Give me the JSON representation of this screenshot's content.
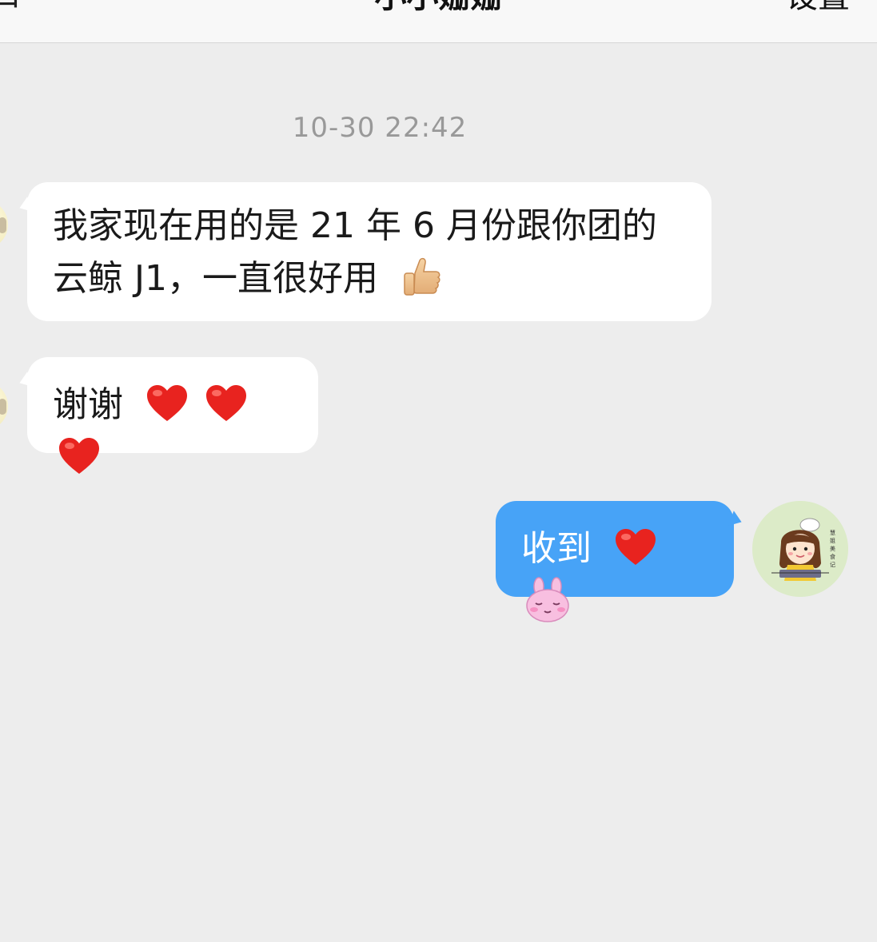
{
  "header": {
    "back_label": "口",
    "title": "小小姗姗",
    "settings_label": "设置"
  },
  "chat": {
    "timestamp": "10-30 22:42",
    "messages": [
      {
        "direction": "incoming",
        "text_line1": "我家现在用的是 21 年 6 月份跟你团的",
        "text_line2": "云鲸 J1，一直很好用",
        "emoji": "thumbs-up"
      },
      {
        "direction": "incoming",
        "text": "谢谢",
        "emoji": [
          "heart",
          "heart",
          "heart"
        ]
      },
      {
        "direction": "outgoing",
        "text": "收到",
        "emoji": [
          "heart",
          "bunny-face"
        ]
      }
    ],
    "outgoing_avatar_caption": "慧姐美食记"
  },
  "colors": {
    "background": "#ededed",
    "header_bg": "#f8f8f8",
    "incoming_bubble": "#ffffff",
    "outgoing_bubble": "#47a3f7",
    "timestamp": "#999999",
    "heart": "#e8231f"
  }
}
